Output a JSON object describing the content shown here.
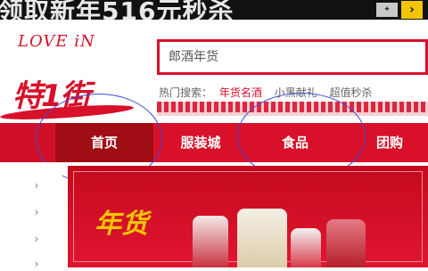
{
  "top_banner": {
    "promo_text": "领取新年516元秒杀",
    "corner_icon": "arrow-icon"
  },
  "logo": {
    "love_text": "LOVE iN",
    "cn_text": "特1街"
  },
  "search": {
    "placeholder": "郎酒年货"
  },
  "hot_search": {
    "label": "热门搜索：",
    "links": [
      "年货名酒",
      "小黑献礼",
      "超值秒杀"
    ]
  },
  "nav": {
    "items": [
      "首页",
      "服装城",
      "食品",
      "团购"
    ],
    "active_index": 0
  },
  "banner": {
    "title": "年货",
    "colors": {
      "accent": "#d8102a",
      "active": "#a00d14",
      "gold": "#f4c400"
    }
  }
}
